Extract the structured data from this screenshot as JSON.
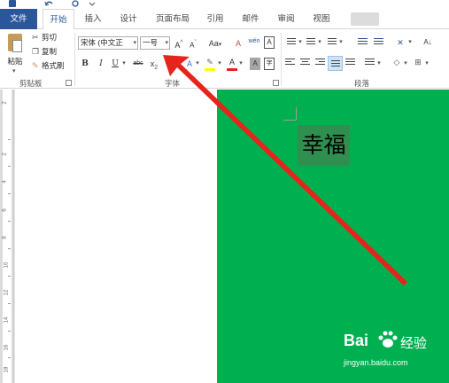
{
  "tabs": [
    {
      "label": "文件"
    },
    {
      "label": "开始"
    },
    {
      "label": "插入"
    },
    {
      "label": "设计"
    },
    {
      "label": "页面布局"
    },
    {
      "label": "引用"
    },
    {
      "label": "邮件"
    },
    {
      "label": "审阅"
    },
    {
      "label": "视图"
    }
  ],
  "clipboard": {
    "paste_label": "粘贴",
    "cut_label": "剪切",
    "copy_label": "复制",
    "format_painter_label": "格式刷",
    "group_label": "剪贴板"
  },
  "font": {
    "font_name": "宋体 (中文正",
    "font_size": "一号",
    "grow_label": "A",
    "shrink_label": "A",
    "case_label": "Aa",
    "bold_label": "B",
    "italic_label": "I",
    "underline_label": "U",
    "strike_label": "abc",
    "subscript_label": "x",
    "group_label": "字体"
  },
  "paragraph": {
    "group_label": "段落"
  },
  "document": {
    "text": "幸福"
  },
  "watermark": {
    "logo_text": "Bai",
    "logo_suffix": "经验",
    "url": "jingyan.baidu.com"
  },
  "ruler": {
    "numbers": [
      "2",
      "2",
      "4",
      "6",
      "8",
      "10",
      "12",
      "14",
      "16",
      "18"
    ]
  },
  "colors": {
    "brand_blue": "#2b579a",
    "page_green": "#00b050",
    "arrow_red": "#e5241b"
  }
}
